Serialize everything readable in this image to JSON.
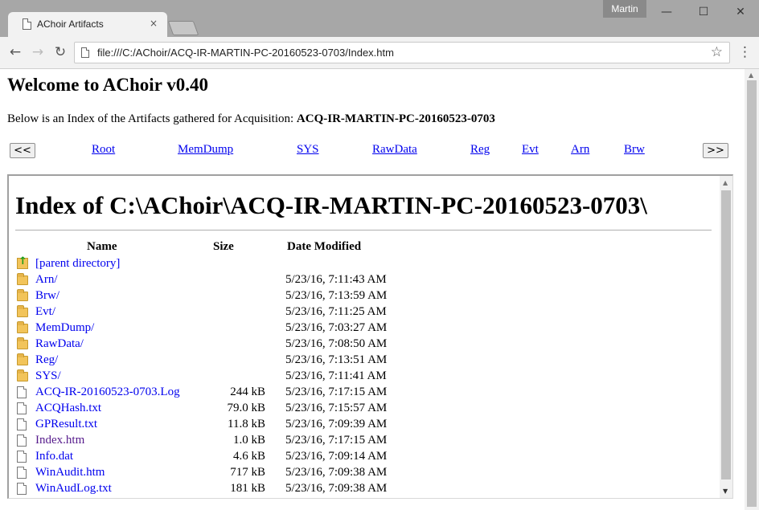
{
  "browser": {
    "user": "Martin",
    "tab": {
      "title": "AChoir Artifacts",
      "close": "×"
    },
    "window_buttons": {
      "minimize": "—",
      "maximize": "☐",
      "close": "✕"
    },
    "nav": {
      "back": "←",
      "forward": "→",
      "reload": "↻"
    },
    "address": "file:///C:/AChoir/ACQ-IR-MARTIN-PC-20160523-0703/Index.htm",
    "star": "☆",
    "menu": "⋮"
  },
  "page": {
    "heading": "Welcome to AChoir v0.40",
    "intro_text": "Below is an Index of the Artifacts gathered for Acquisition: ",
    "acquisition": "ACQ-IR-MARTIN-PC-20160523-0703",
    "prev_button": "<<",
    "next_button": ">>",
    "links": [
      "Root",
      "MemDump",
      "SYS",
      "RawData",
      "Reg",
      "Evt",
      "Arn",
      "Brw"
    ]
  },
  "index": {
    "title": "Index of C:\\AChoir\\ACQ-IR-MARTIN-PC-20160523-0703\\",
    "columns": {
      "name": "Name",
      "size": "Size",
      "date": "Date Modified"
    },
    "parent": "[parent directory]",
    "rows": [
      {
        "name": "Arn/",
        "size": "",
        "date": "5/23/16, 7:11:43 AM",
        "kind": "folder"
      },
      {
        "name": "Brw/",
        "size": "",
        "date": "5/23/16, 7:13:59 AM",
        "kind": "folder"
      },
      {
        "name": "Evt/",
        "size": "",
        "date": "5/23/16, 7:11:25 AM",
        "kind": "folder"
      },
      {
        "name": "MemDump/",
        "size": "",
        "date": "5/23/16, 7:03:27 AM",
        "kind": "folder"
      },
      {
        "name": "RawData/",
        "size": "",
        "date": "5/23/16, 7:08:50 AM",
        "kind": "folder"
      },
      {
        "name": "Reg/",
        "size": "",
        "date": "5/23/16, 7:13:51 AM",
        "kind": "folder"
      },
      {
        "name": "SYS/",
        "size": "",
        "date": "5/23/16, 7:11:41 AM",
        "kind": "folder"
      },
      {
        "name": "ACQ-IR-20160523-0703.Log",
        "size": "244 kB",
        "date": "5/23/16, 7:17:15 AM",
        "kind": "file"
      },
      {
        "name": "ACQHash.txt",
        "size": "79.0 kB",
        "date": "5/23/16, 7:15:57 AM",
        "kind": "file"
      },
      {
        "name": "GPResult.txt",
        "size": "11.8 kB",
        "date": "5/23/16, 7:09:39 AM",
        "kind": "file"
      },
      {
        "name": "Index.htm",
        "size": "1.0 kB",
        "date": "5/23/16, 7:17:15 AM",
        "kind": "file",
        "visited": true
      },
      {
        "name": "Info.dat",
        "size": "4.6 kB",
        "date": "5/23/16, 7:09:14 AM",
        "kind": "file"
      },
      {
        "name": "WinAudit.htm",
        "size": "717 kB",
        "date": "5/23/16, 7:09:38 AM",
        "kind": "file"
      },
      {
        "name": "WinAudLog.txt",
        "size": "181 kB",
        "date": "5/23/16, 7:09:38 AM",
        "kind": "file"
      }
    ]
  },
  "colors": {
    "link": "#0000ee",
    "visited": "#551a8b"
  },
  "icons": {
    "tab_page": "page-icon",
    "folder": "folder-icon",
    "file": "file-icon",
    "parent": "parent-folder-icon"
  }
}
